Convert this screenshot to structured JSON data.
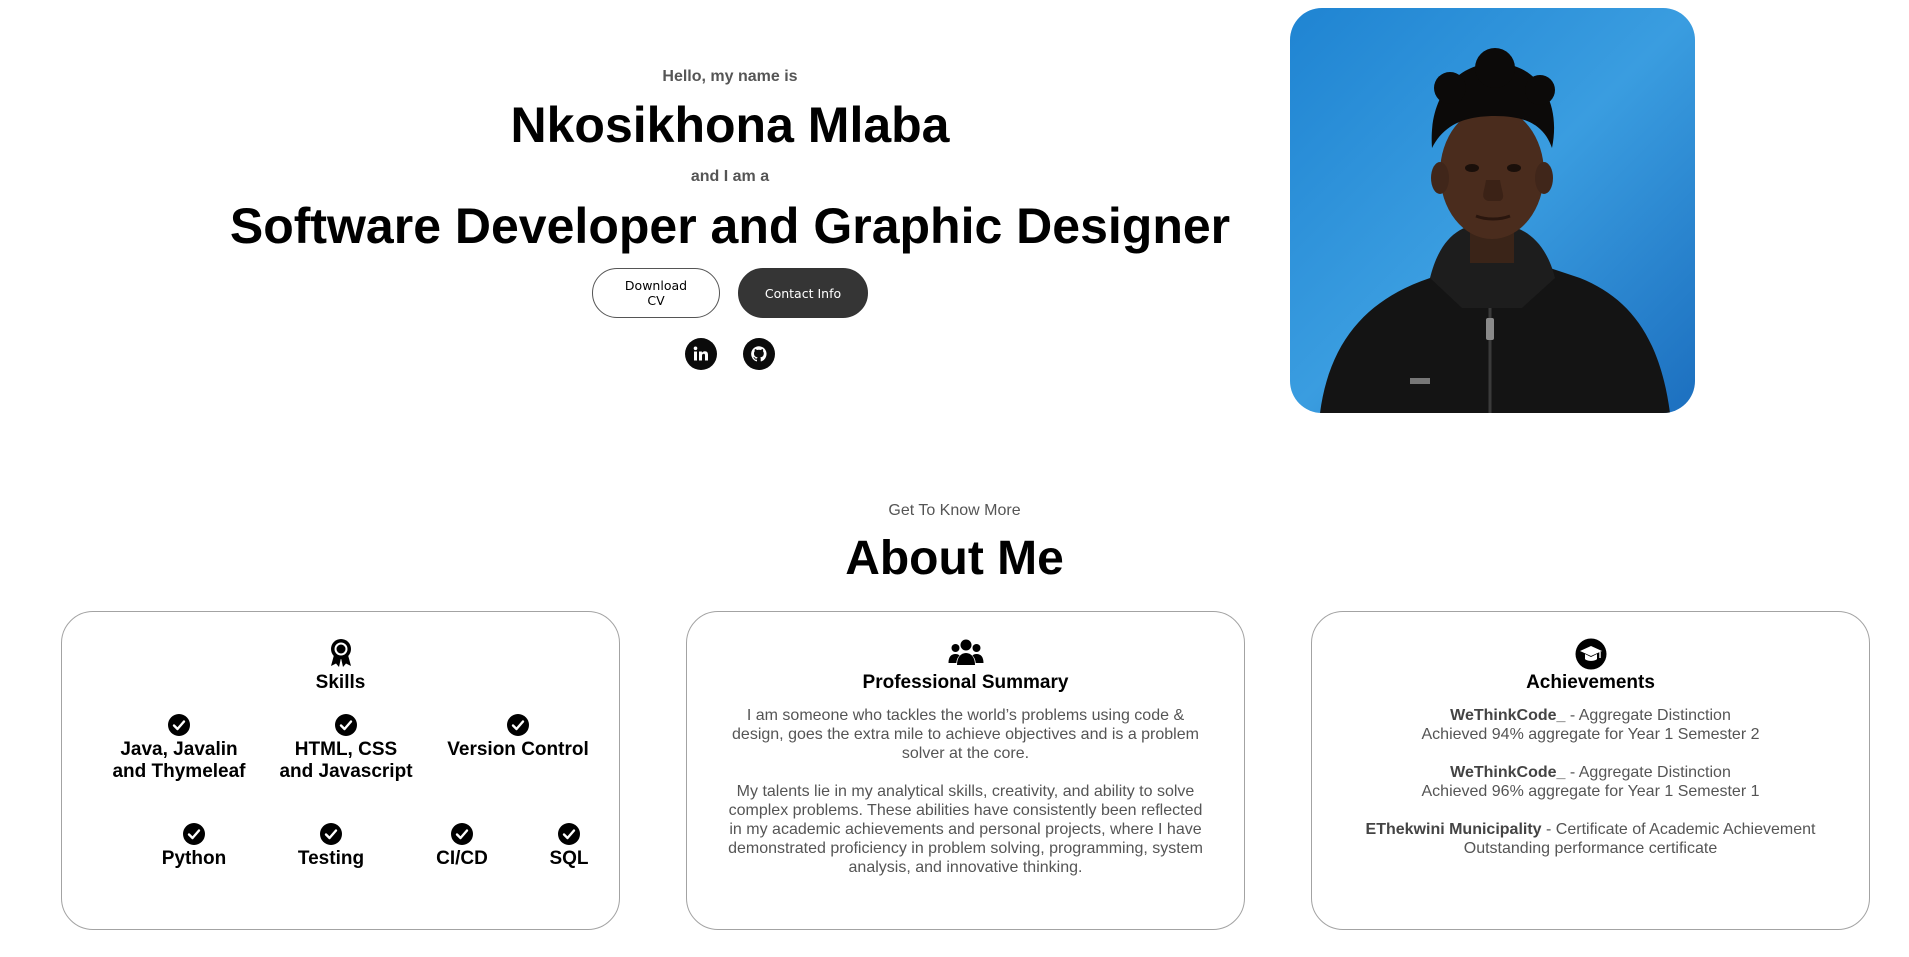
{
  "hero": {
    "greeting": "Hello, my name is",
    "name": "Nkosikhona Mlaba",
    "intro": "and I am a",
    "role": "Software Developer and Graphic Designer",
    "buttons": {
      "download_cv": "Download CV",
      "contact_info": "Contact Info"
    },
    "socials": [
      {
        "icon": "linkedin-icon"
      },
      {
        "icon": "github-icon"
      }
    ]
  },
  "about": {
    "subtitle": "Get To Know More",
    "title": "About Me",
    "skills_card": {
      "icon": "award-icon",
      "title": "Skills",
      "items": [
        {
          "line1": "Java, Javalin",
          "line2": "and Thymeleaf"
        },
        {
          "line1": "HTML, CSS",
          "line2": "and Javascript"
        },
        {
          "line1": "Version Control",
          "line2": ""
        },
        {
          "line1": "Python",
          "line2": ""
        },
        {
          "line1": "Testing",
          "line2": ""
        },
        {
          "line1": "CI/CD",
          "line2": ""
        },
        {
          "line1": "SQL",
          "line2": ""
        }
      ]
    },
    "summary_card": {
      "icon": "users-icon",
      "title": "Professional Summary",
      "paragraph1": "I am someone who tackles the world’s problems using code & design, goes the extra mile to achieve objectives and is a problem solver at the core.",
      "paragraph2": "My talents lie in my analytical skills, creativity, and ability to solve complex problems. These abilities have consistently been reflected in my academic achievements and personal projects, where I have demonstrated proficiency in problem solving, programming, system analysis, and innovative thinking."
    },
    "achievements_card": {
      "icon": "graduation-cap-icon",
      "title": "Achievements",
      "items": [
        {
          "org": "WeThinkCode_",
          "award": " - Aggregate Distinction",
          "detail": "Achieved 94% aggregate for Year 1 Semester 2"
        },
        {
          "org": "WeThinkCode_",
          "award": " - Aggregate Distinction",
          "detail": "Achieved 96% aggregate for Year 1 Semester 1"
        },
        {
          "org": "EThekwini Municipality",
          "award": " - Certificate of Academic Achievement",
          "detail": "Outstanding performance certificate"
        }
      ]
    }
  },
  "colors": {
    "text": "#000000",
    "muted": "#555555",
    "dark_button": "#353535",
    "card_border": "#a3a3a3",
    "photo_bg": "#2f8fd6"
  }
}
